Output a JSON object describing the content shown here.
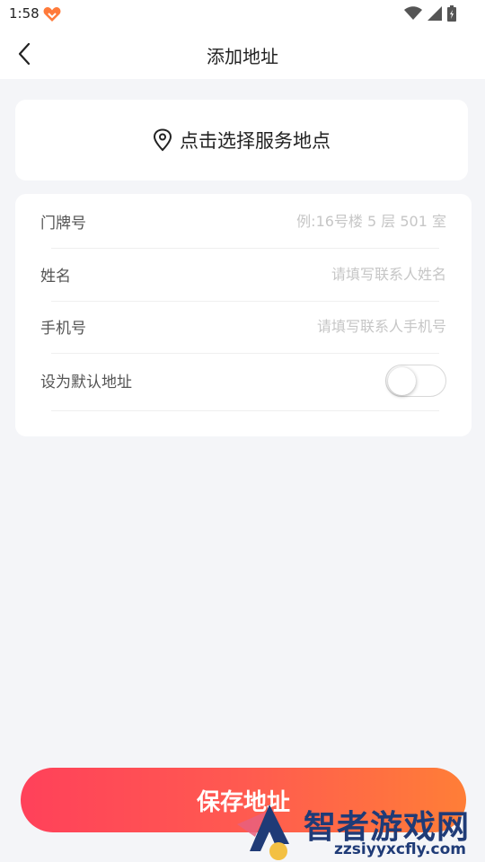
{
  "status_bar": {
    "time": "1:58",
    "icons": [
      "app-heart-icon",
      "wifi-icon",
      "signal-icon",
      "battery-icon"
    ]
  },
  "nav": {
    "title": "添加地址",
    "back_icon": "chevron-left-icon"
  },
  "location_picker": {
    "icon": "map-pin-icon",
    "label": "点击选择服务地点"
  },
  "form": {
    "house_number": {
      "label": "门牌号",
      "placeholder": "例:16号楼 5 层 501 室",
      "value": ""
    },
    "name": {
      "label": "姓名",
      "placeholder": "请填写联系人姓名",
      "value": ""
    },
    "phone": {
      "label": "手机号",
      "placeholder": "请填写联系人手机号",
      "value": ""
    },
    "default_address": {
      "label": "设为默认地址",
      "enabled": false
    }
  },
  "save_button": {
    "label": "保存地址"
  },
  "watermark": {
    "text": "智者游戏网",
    "url": "zzsiyyxcfly.com"
  },
  "colors": {
    "accent_start": "#ff415a",
    "accent_end": "#ff7e37",
    "background": "#f4f5f8",
    "card": "#ffffff",
    "placeholder": "#c6c6c6",
    "watermark_blue": "#1f3b77"
  }
}
